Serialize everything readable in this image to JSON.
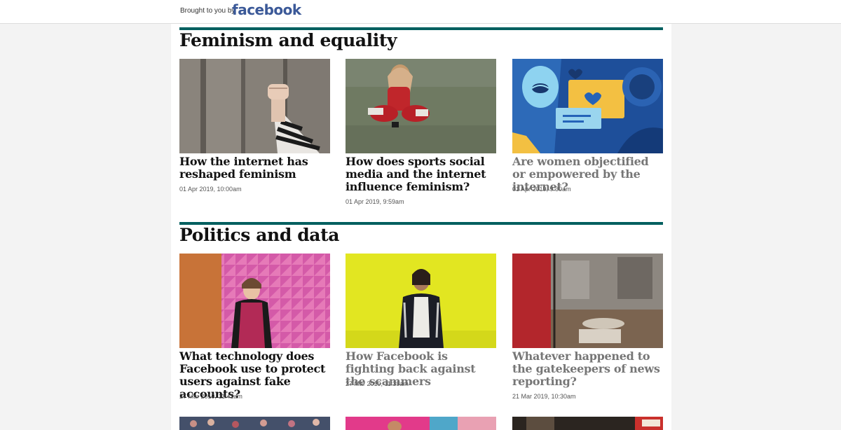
{
  "header": {
    "sponsor_text": "Brought to you by",
    "sponsor_logo": "facebook",
    "logo_color": "#3b5998"
  },
  "sections": [
    {
      "title": "Feminism and equality",
      "articles": [
        {
          "headline": "How the internet has reshaped feminism",
          "date": "01 Apr 2019, 10:00am",
          "image": "raised-fist-photo"
        },
        {
          "headline": "How does sports social media and the internet influence feminism?",
          "date": "01 Apr 2019, 9:59am",
          "image": "footballer-sitting-photo"
        },
        {
          "headline": "Are women objectified or empowered by the internet?",
          "date": "01 Apr 2019, 9:30am",
          "image": "social-media-illustration"
        }
      ]
    },
    {
      "title": "Politics and data",
      "articles": [
        {
          "headline": "What technology does Facebook use to protect users against fake accounts?",
          "date": "27 Mar 2019, 11:42am",
          "image": "woman-pink-wall-photo"
        },
        {
          "headline": "How Facebook is fighting back against the scammers",
          "date": "27 Mar 2019, 11:39am",
          "image": "woman-yellow-wall-photo"
        },
        {
          "headline": "Whatever happened to the gatekeepers of news reporting?",
          "date": "21 Mar 2019, 10:30am",
          "image": "cafe-window-photo"
        }
      ]
    }
  ],
  "colors": {
    "section_rule": "#005f5f",
    "headline": "#121212",
    "headline_muted": "#767676"
  }
}
